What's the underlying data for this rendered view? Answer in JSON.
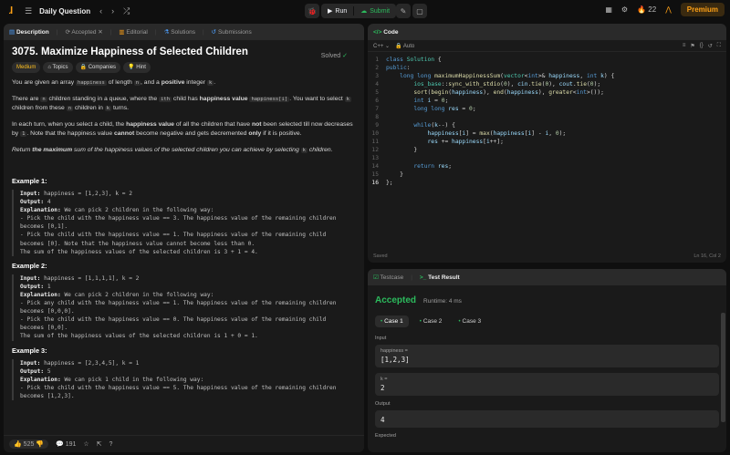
{
  "topbar": {
    "title": "Daily Question",
    "run": "Run",
    "submit": "Submit",
    "streak": "22",
    "premium": "Premium"
  },
  "tabs": {
    "description": "Description",
    "accepted": "Accepted",
    "editorial": "Editorial",
    "solutions": "Solutions",
    "submissions": "Submissions"
  },
  "problem": {
    "title": "3075. Maximize Happiness of Selected Children",
    "solved": "Solved",
    "difficulty": "Medium",
    "topics": "Topics",
    "companies": "Companies",
    "hint": "Hint",
    "p1a": "You are given an array ",
    "p1code": "happiness",
    "p1b": " of length ",
    "p1n": "n",
    "p1c": ", and a ",
    "p1pos": "positive",
    "p1d": " integer ",
    "p1k": "k",
    ".": ".",
    "p2a": "There are ",
    "p2n": "n",
    "p2b": " children standing in a queue, where the ",
    "p2i": "ith",
    "p2c": " child has ",
    "p2hv": "happiness value",
    "p2code": "happiness[i]",
    "p2d": ". You want to select ",
    "p2k": "k",
    "p2e": " children from these ",
    "p2n2": "n",
    "p2f": " children in ",
    "p2k2": "k",
    "p2g": " turns.",
    "p3a": "In each turn, when you select a child, the ",
    "p3hv": "happiness value",
    "p3b": " of all the children that have ",
    "p3not": "not",
    "p3c": " been selected till now decreases by ",
    "p3one": "1",
    "p3d": ". Note that the happiness value ",
    "p3cannot": "cannot",
    "p3e": " become negative and gets decremented ",
    "p3only": "only",
    "p3f": " if it is positive.",
    "p4a": "Return ",
    "p4max": "the maximum",
    "p4b": " sum of the happiness values of the selected children you can achieve by selecting ",
    "p4k": "k",
    "p4c": " children.",
    "ex1": "Example 1:",
    "ex2": "Example 2:",
    "ex3": "Example 3:",
    "e1in": "happiness = [1,2,3], k = 2",
    "e1out": "4",
    "e1exp": "We can pick 2 children in the following way:",
    "e1l1": "- Pick the child with the happiness value == 3. The happiness value of the remaining children",
    "e1l2": "becomes [0,1].",
    "e1l3": "- Pick the child with the happiness value == 1. The happiness value of the remaining child",
    "e1l4": "becomes [0]. Note that the happiness value cannot become less than 0.",
    "e1l5": "The sum of the happiness values of the selected children is 3 + 1 = 4.",
    "e2in": "happiness = [1,1,1,1], k = 2",
    "e2out": "1",
    "e2exp": "We can pick 2 children in the following way:",
    "e2l1": "- Pick any child with the happiness value == 1. The happiness value of the remaining children",
    "e2l2": "becomes [0,0,0].",
    "e2l3": "- Pick the child with the happiness value == 0. The happiness value of the remaining child",
    "e2l4": "becomes [0,0].",
    "e2l5": "The sum of the happiness values of the selected children is 1 + 0 = 1.",
    "e3in": "happiness = [2,3,4,5], k = 1",
    "e3out": "5",
    "e3exp": "We can pick 1 child in the following way:",
    "e3l1": "- Pick the child with the happiness value == 5. The happiness value of the remaining children",
    "e3l2": "becomes [1,2,3]."
  },
  "labels": {
    "input": "Input:",
    "output": "Output:",
    "explanation": "Explanation:"
  },
  "footer": {
    "likes": "525",
    "comments": "191"
  },
  "code": {
    "tab": "Code",
    "lang": "C++",
    "auto": "Auto",
    "saved": "Saved",
    "cursor": "Ln 16, Col 2"
  },
  "result": {
    "testcase": "Testcase",
    "testresult": "Test Result",
    "status": "Accepted",
    "runtime": "Runtime: 4 ms",
    "case1": "Case 1",
    "case2": "Case 2",
    "case3": "Case 3",
    "input": "Input",
    "k1": "happiness =",
    "v1": "[1,2,3]",
    "k2": "k =",
    "v2": "2",
    "output": "Output",
    "out": "4",
    "expected": "Expected"
  }
}
